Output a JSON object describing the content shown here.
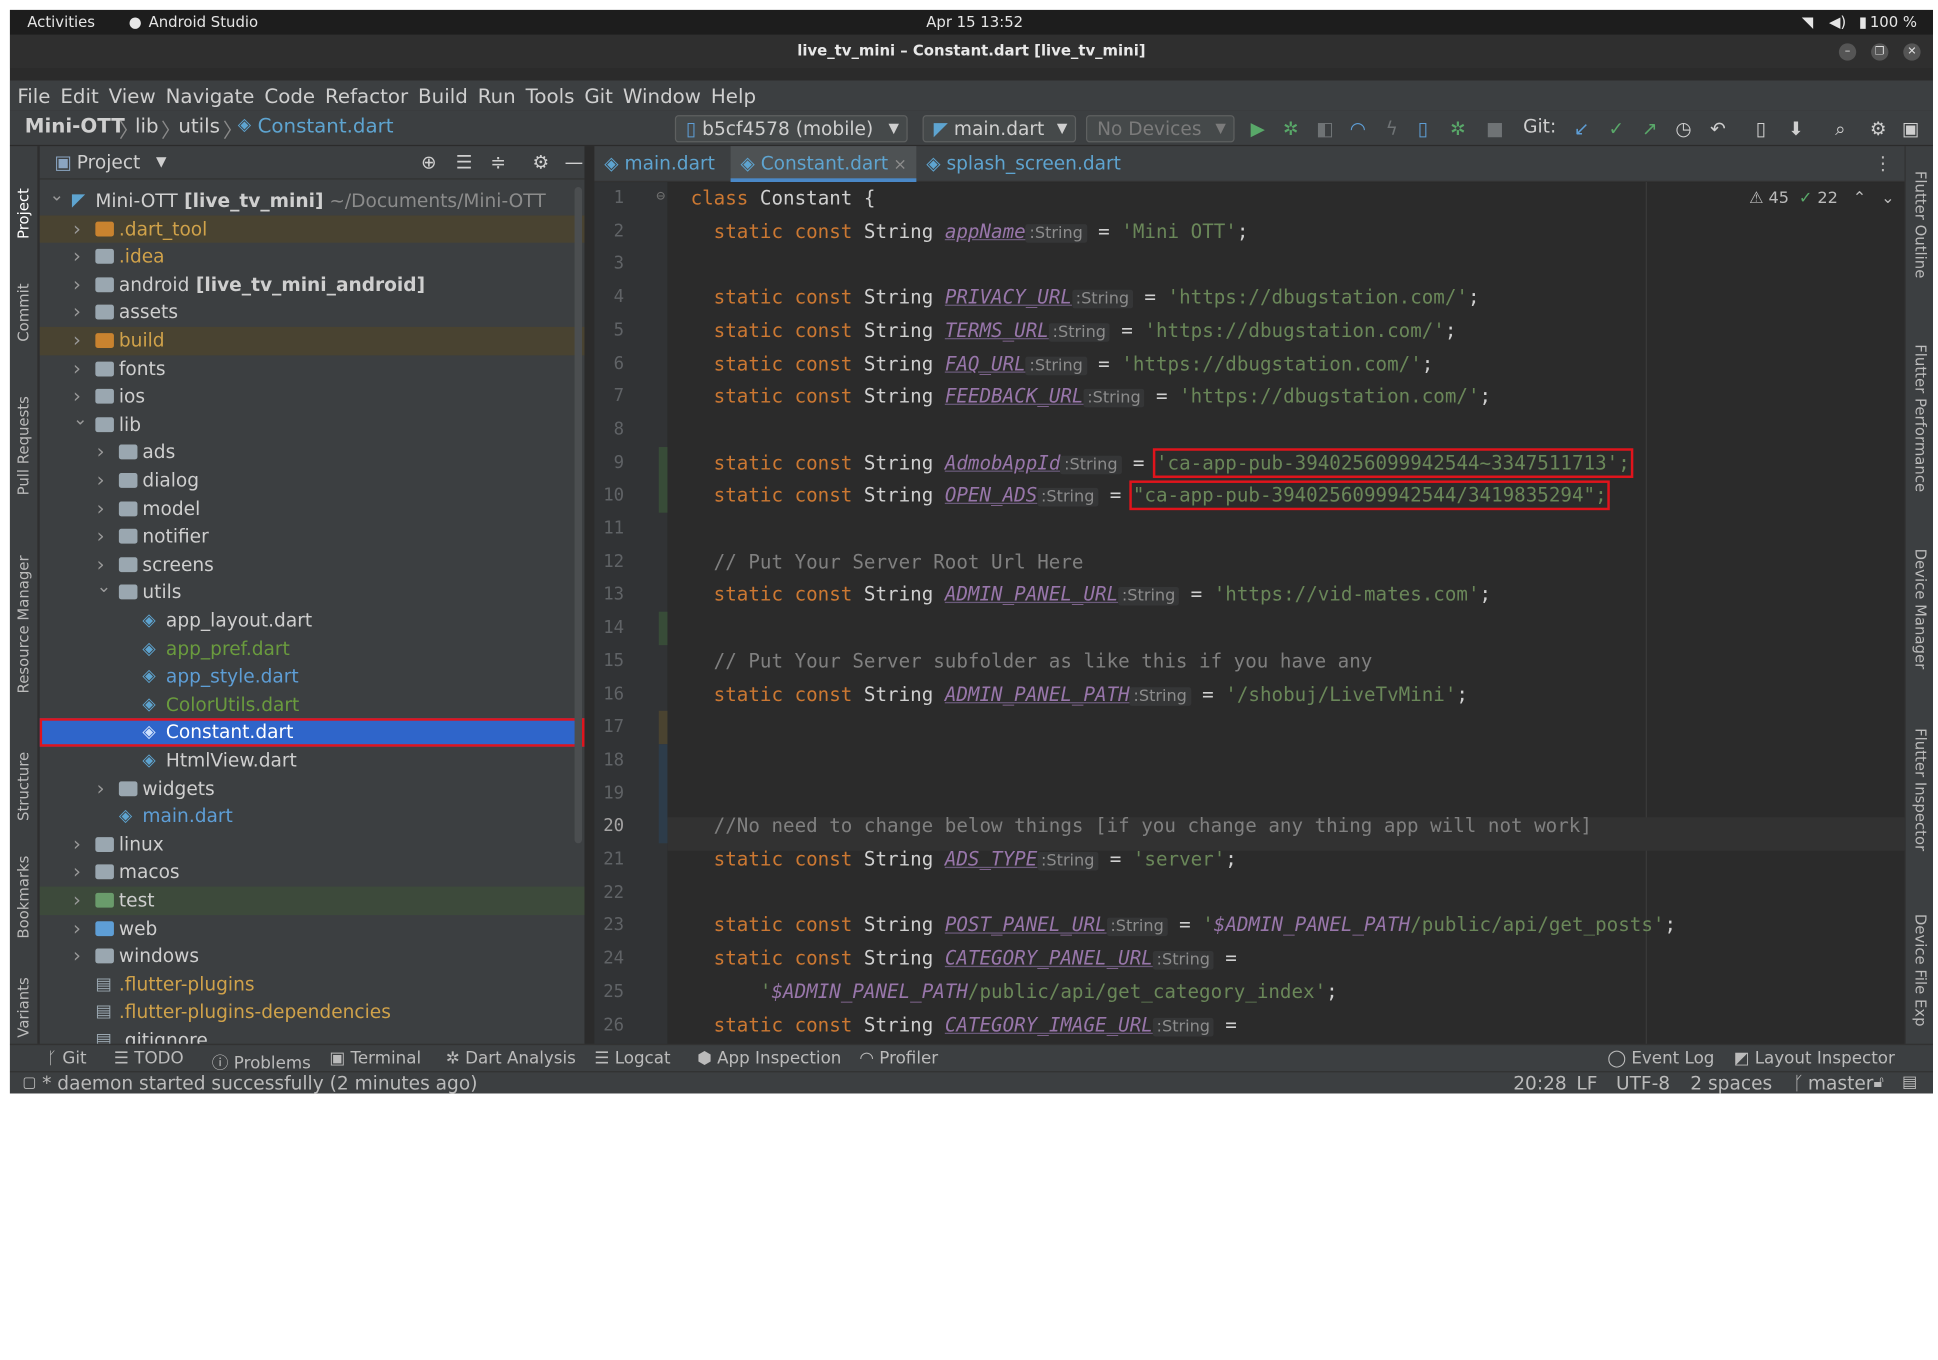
{
  "system": {
    "activities": "Activities",
    "app_name": "Android Studio",
    "datetime": "Apr 15  13:52",
    "battery": "100 %"
  },
  "window": {
    "title": "live_tv_mini – Constant.dart [live_tv_mini]"
  },
  "menu": [
    "File",
    "Edit",
    "View",
    "Navigate",
    "Code",
    "Refactor",
    "Build",
    "Run",
    "Tools",
    "Git",
    "Window",
    "Help"
  ],
  "breadcrumb": {
    "project": "Mini-OTT",
    "lib": "lib",
    "utils": "utils",
    "file": "Constant.dart"
  },
  "toolbar": {
    "device": "b5cf4578 (mobile)",
    "run_config": "main.dart",
    "no_devices": "No Devices",
    "git_label": "Git:"
  },
  "project_panel": {
    "title": "Project"
  },
  "tree": [
    {
      "name": "Mini-OTT",
      "bold": " [live_tv_mini]",
      "path": " ~/Documents/Mini-OTT",
      "depth": 0,
      "arrow": "open",
      "kind": "flutter",
      "color": "#cfcfcf"
    },
    {
      "name": ".dart_tool",
      "depth": 1,
      "arrow": "closed",
      "kind": "folder-orange",
      "color": "#d0a24a",
      "bg": "#494331"
    },
    {
      "name": ".idea",
      "depth": 1,
      "arrow": "closed",
      "kind": "folder-gray",
      "color": "#d0a24a"
    },
    {
      "name": "android",
      "bold": " [live_tv_mini_android]",
      "depth": 1,
      "arrow": "closed",
      "kind": "folder-gray",
      "color": "#cfcfcf"
    },
    {
      "name": "assets",
      "depth": 1,
      "arrow": "closed",
      "kind": "folder-gray",
      "color": "#cfcfcf"
    },
    {
      "name": "build",
      "depth": 1,
      "arrow": "closed",
      "kind": "folder-orange",
      "color": "#d0a24a",
      "bg": "#494331"
    },
    {
      "name": "fonts",
      "depth": 1,
      "arrow": "closed",
      "kind": "folder-gray",
      "color": "#cfcfcf"
    },
    {
      "name": "ios",
      "depth": 1,
      "arrow": "closed",
      "kind": "folder-gray",
      "color": "#cfcfcf"
    },
    {
      "name": "lib",
      "depth": 1,
      "arrow": "open",
      "kind": "folder-gray",
      "color": "#cfcfcf"
    },
    {
      "name": "ads",
      "depth": 2,
      "arrow": "closed",
      "kind": "folder-gray",
      "color": "#cfcfcf"
    },
    {
      "name": "dialog",
      "depth": 2,
      "arrow": "closed",
      "kind": "folder-gray",
      "color": "#cfcfcf"
    },
    {
      "name": "model",
      "depth": 2,
      "arrow": "closed",
      "kind": "folder-gray",
      "color": "#cfcfcf"
    },
    {
      "name": "notifier",
      "depth": 2,
      "arrow": "closed",
      "kind": "folder-gray",
      "color": "#cfcfcf"
    },
    {
      "name": "screens",
      "depth": 2,
      "arrow": "closed",
      "kind": "folder-gray",
      "color": "#cfcfcf"
    },
    {
      "name": "utils",
      "depth": 2,
      "arrow": "open",
      "kind": "folder-gray",
      "color": "#cfcfcf"
    },
    {
      "name": "app_layout.dart",
      "depth": 3,
      "kind": "dart",
      "color": "#cfcfcf"
    },
    {
      "name": "app_pref.dart",
      "depth": 3,
      "kind": "dart",
      "color": "#6a9b3e"
    },
    {
      "name": "app_style.dart",
      "depth": 3,
      "kind": "dart",
      "color": "#5e9ed6"
    },
    {
      "name": "ColorUtils.dart",
      "depth": 3,
      "kind": "dart",
      "color": "#6a9b3e"
    },
    {
      "name": "Constant.dart",
      "depth": 3,
      "kind": "dart",
      "color": "#ffffff",
      "selected": true
    },
    {
      "name": "HtmlView.dart",
      "depth": 3,
      "kind": "dart",
      "color": "#cfcfcf"
    },
    {
      "name": "widgets",
      "depth": 2,
      "arrow": "closed",
      "kind": "folder-gray",
      "color": "#cfcfcf"
    },
    {
      "name": "main.dart",
      "depth": 2,
      "kind": "dart",
      "color": "#5e9ed6"
    },
    {
      "name": "linux",
      "depth": 1,
      "arrow": "closed",
      "kind": "folder-gray",
      "color": "#cfcfcf"
    },
    {
      "name": "macos",
      "depth": 1,
      "arrow": "closed",
      "kind": "folder-gray",
      "color": "#cfcfcf"
    },
    {
      "name": "test",
      "depth": 1,
      "arrow": "closed",
      "kind": "folder-green",
      "color": "#cfcfcf",
      "bg": "#3d4a3b"
    },
    {
      "name": "web",
      "depth": 1,
      "arrow": "closed",
      "kind": "folder-web",
      "color": "#cfcfcf"
    },
    {
      "name": "windows",
      "depth": 1,
      "arrow": "closed",
      "kind": "folder-gray",
      "color": "#cfcfcf"
    },
    {
      "name": ".flutter-plugins",
      "depth": 1,
      "kind": "file",
      "color": "#d0a24a"
    },
    {
      "name": ".flutter-plugins-dependencies",
      "depth": 1,
      "kind": "file",
      "color": "#d0a24a"
    },
    {
      "name": ".gitignore",
      "depth": 1,
      "kind": "file",
      "color": "#cfcfcf"
    }
  ],
  "editor_tabs": [
    {
      "label": "main.dart",
      "active": false
    },
    {
      "label": "Constant.dart",
      "active": true
    },
    {
      "label": "splash_screen.dart",
      "active": false
    }
  ],
  "inspections": {
    "warnings": "45",
    "weak": "22"
  },
  "code_lines": [
    [
      [
        "kw",
        "class"
      ],
      [
        "ty",
        " Constant {"
      ]
    ],
    [
      [
        "pad",
        "  "
      ],
      [
        "kw",
        "static const "
      ],
      [
        "ty",
        "String "
      ],
      [
        "fld",
        "appName"
      ],
      [
        "hint",
        ":String"
      ],
      [
        "ty",
        " = "
      ],
      [
        "str",
        "'Mini OTT'"
      ],
      [
        "ty",
        ";"
      ]
    ],
    [],
    [
      [
        "pad",
        "  "
      ],
      [
        "kw",
        "static const "
      ],
      [
        "ty",
        "String "
      ],
      [
        "fld",
        "PRIVACY_URL"
      ],
      [
        "hint",
        ":String"
      ],
      [
        "ty",
        " = "
      ],
      [
        "str",
        "'https://dbugstation.com/'"
      ],
      [
        "ty",
        ";"
      ]
    ],
    [
      [
        "pad",
        "  "
      ],
      [
        "kw",
        "static const "
      ],
      [
        "ty",
        "String "
      ],
      [
        "fld",
        "TERMS_URL"
      ],
      [
        "hint",
        ":String"
      ],
      [
        "ty",
        " = "
      ],
      [
        "str",
        "'https://dbugstation.com/'"
      ],
      [
        "ty",
        ";"
      ]
    ],
    [
      [
        "pad",
        "  "
      ],
      [
        "kw",
        "static const "
      ],
      [
        "ty",
        "String "
      ],
      [
        "fld",
        "FAQ_URL"
      ],
      [
        "hint",
        ":String"
      ],
      [
        "ty",
        " = "
      ],
      [
        "str",
        "'https://dbugstation.com/'"
      ],
      [
        "ty",
        ";"
      ]
    ],
    [
      [
        "pad",
        "  "
      ],
      [
        "kw",
        "static const "
      ],
      [
        "ty",
        "String "
      ],
      [
        "fld",
        "FEEDBACK_URL"
      ],
      [
        "hint",
        ":String"
      ],
      [
        "ty",
        " = "
      ],
      [
        "str",
        "'https://dbugstation.com/'"
      ],
      [
        "ty",
        ";"
      ]
    ],
    [],
    [
      [
        "pad",
        "  "
      ],
      [
        "kw",
        "static const "
      ],
      [
        "ty",
        "String "
      ],
      [
        "fld",
        "AdmobAppId"
      ],
      [
        "hint",
        ":String"
      ],
      [
        "ty",
        " = "
      ],
      [
        "strhl",
        "'ca-app-pub-3940256099942544~3347511713';"
      ]
    ],
    [
      [
        "pad",
        "  "
      ],
      [
        "kw",
        "static const "
      ],
      [
        "ty",
        "String "
      ],
      [
        "fld",
        "OPEN_ADS"
      ],
      [
        "hint",
        ":String"
      ],
      [
        "ty",
        " = "
      ],
      [
        "strhl",
        "\"ca-app-pub-3940256099942544/3419835294\";"
      ]
    ],
    [],
    [
      [
        "pad",
        "  "
      ],
      [
        "cm",
        "// Put Your Server Root Url Here"
      ]
    ],
    [
      [
        "pad",
        "  "
      ],
      [
        "kw",
        "static const "
      ],
      [
        "ty",
        "String "
      ],
      [
        "fld",
        "ADMIN_PANEL_URL"
      ],
      [
        "hint",
        ":String"
      ],
      [
        "ty",
        " = "
      ],
      [
        "str",
        "'https://vid-mates.com'"
      ],
      [
        "ty",
        ";"
      ]
    ],
    [],
    [
      [
        "pad",
        "  "
      ],
      [
        "cm",
        "// Put Your Server subfolder as like this if you have any"
      ]
    ],
    [
      [
        "pad",
        "  "
      ],
      [
        "kw",
        "static const "
      ],
      [
        "ty",
        "String "
      ],
      [
        "fld",
        "ADMIN_PANEL_PATH"
      ],
      [
        "hint",
        ":String"
      ],
      [
        "ty",
        " = "
      ],
      [
        "str",
        "'/shobuj/LiveTvMini'"
      ],
      [
        "ty",
        ";"
      ]
    ],
    [],
    [],
    [],
    [
      [
        "pad",
        "  "
      ],
      [
        "cm",
        "//No need to change below things [if you change any thing app will not work]"
      ]
    ],
    [
      [
        "pad",
        "  "
      ],
      [
        "kw",
        "static const "
      ],
      [
        "ty",
        "String "
      ],
      [
        "fld",
        "ADS_TYPE"
      ],
      [
        "hint",
        ":String"
      ],
      [
        "ty",
        " = "
      ],
      [
        "str",
        "'server'"
      ],
      [
        "ty",
        ";"
      ]
    ],
    [],
    [
      [
        "pad",
        "  "
      ],
      [
        "kw",
        "static const "
      ],
      [
        "ty",
        "String "
      ],
      [
        "fld",
        "POST_PANEL_URL"
      ],
      [
        "hint",
        ":String"
      ],
      [
        "ty",
        " = "
      ],
      [
        "str",
        "'"
      ],
      [
        "sv",
        "$ADMIN_PANEL_PATH"
      ],
      [
        "str",
        "/public/api/get_posts'"
      ],
      [
        "ty",
        ";"
      ]
    ],
    [
      [
        "pad",
        "  "
      ],
      [
        "kw",
        "static const "
      ],
      [
        "ty",
        "String "
      ],
      [
        "fld",
        "CATEGORY_PANEL_URL"
      ],
      [
        "hint",
        ":String"
      ],
      [
        "ty",
        " ="
      ]
    ],
    [
      [
        "pad",
        "      "
      ],
      [
        "str",
        "'"
      ],
      [
        "sv",
        "$ADMIN_PANEL_PATH"
      ],
      [
        "str",
        "/public/api/get_category_index'"
      ],
      [
        "ty",
        ";"
      ]
    ],
    [
      [
        "pad",
        "  "
      ],
      [
        "kw",
        "static const "
      ],
      [
        "ty",
        "String "
      ],
      [
        "fld",
        "CATEGORY_IMAGE_URL"
      ],
      [
        "hint",
        ":String"
      ],
      [
        "ty",
        " ="
      ]
    ]
  ],
  "current_line": 20,
  "right_tools": [
    "Flutter Outline",
    "Flutter Performance",
    "Device Manager",
    "Flutter Inspector",
    "Device File Exp"
  ],
  "left_tools": [
    "Project",
    "Commit",
    "Pull Requests",
    "Resource Manager",
    "Structure",
    "Bookmarks",
    "Variants"
  ],
  "bottom_tools": [
    "Git",
    "TODO",
    "Problems",
    "Terminal",
    "Dart Analysis",
    "Logcat",
    "App Inspection",
    "Profiler"
  ],
  "bottom_right_tools": [
    "Event Log",
    "Layout Inspector"
  ],
  "status": {
    "message": "* daemon started successfully (2 minutes ago)",
    "position": "20:28",
    "line_sep": "LF",
    "encoding": "UTF-8",
    "indent": "2 spaces",
    "branch": "master"
  }
}
